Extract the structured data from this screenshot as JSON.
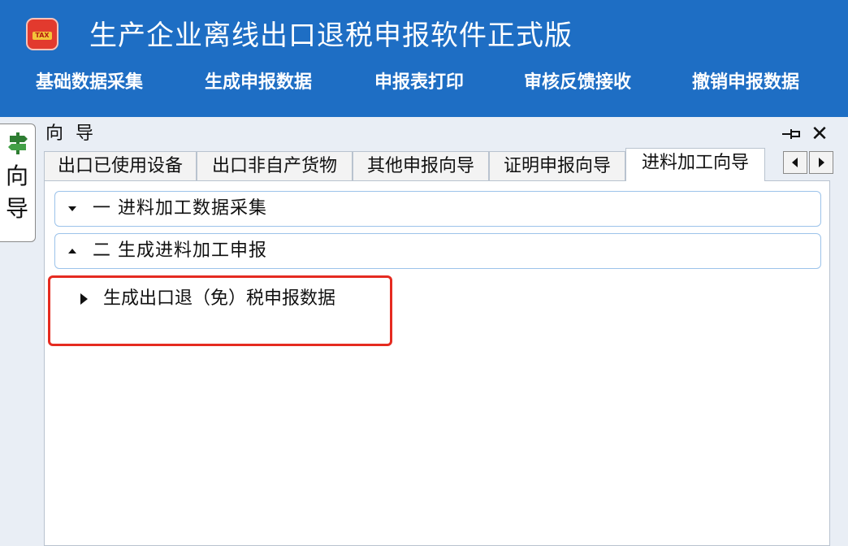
{
  "app": {
    "title": "生产企业离线出口退税申报软件正式版",
    "icon": "tax-icon",
    "icon_text": "TAX"
  },
  "menu": [
    {
      "label": "基础数据采集"
    },
    {
      "label": "生成申报数据"
    },
    {
      "label": "申报表打印"
    },
    {
      "label": "审核反馈接收"
    },
    {
      "label": "撤销申报数据"
    }
  ],
  "side_tab": {
    "label_1": "向",
    "label_2": "导",
    "icon": "signpost-icon"
  },
  "panel": {
    "title": "向 导",
    "pin_icon": "pin-icon",
    "close_symbol": "✕"
  },
  "tabs": [
    {
      "label": "出口已使用设备",
      "active": false
    },
    {
      "label": "出口非自产货物",
      "active": false
    },
    {
      "label": "其他申报向导",
      "active": false
    },
    {
      "label": "证明申报向导",
      "active": false
    },
    {
      "label": "进料加工向导",
      "active": true
    }
  ],
  "sections": [
    {
      "label": "一  进料加工数据采集",
      "state": "collapsed"
    },
    {
      "label": "二  生成进料加工申报",
      "state": "expanded"
    }
  ],
  "task": {
    "label": "生成出口退（免）税申报数据",
    "highlighted": true
  },
  "colors": {
    "titlebar": "#1e6ec4",
    "highlight": "#e52b20",
    "section_border": "#9cc3ea"
  }
}
